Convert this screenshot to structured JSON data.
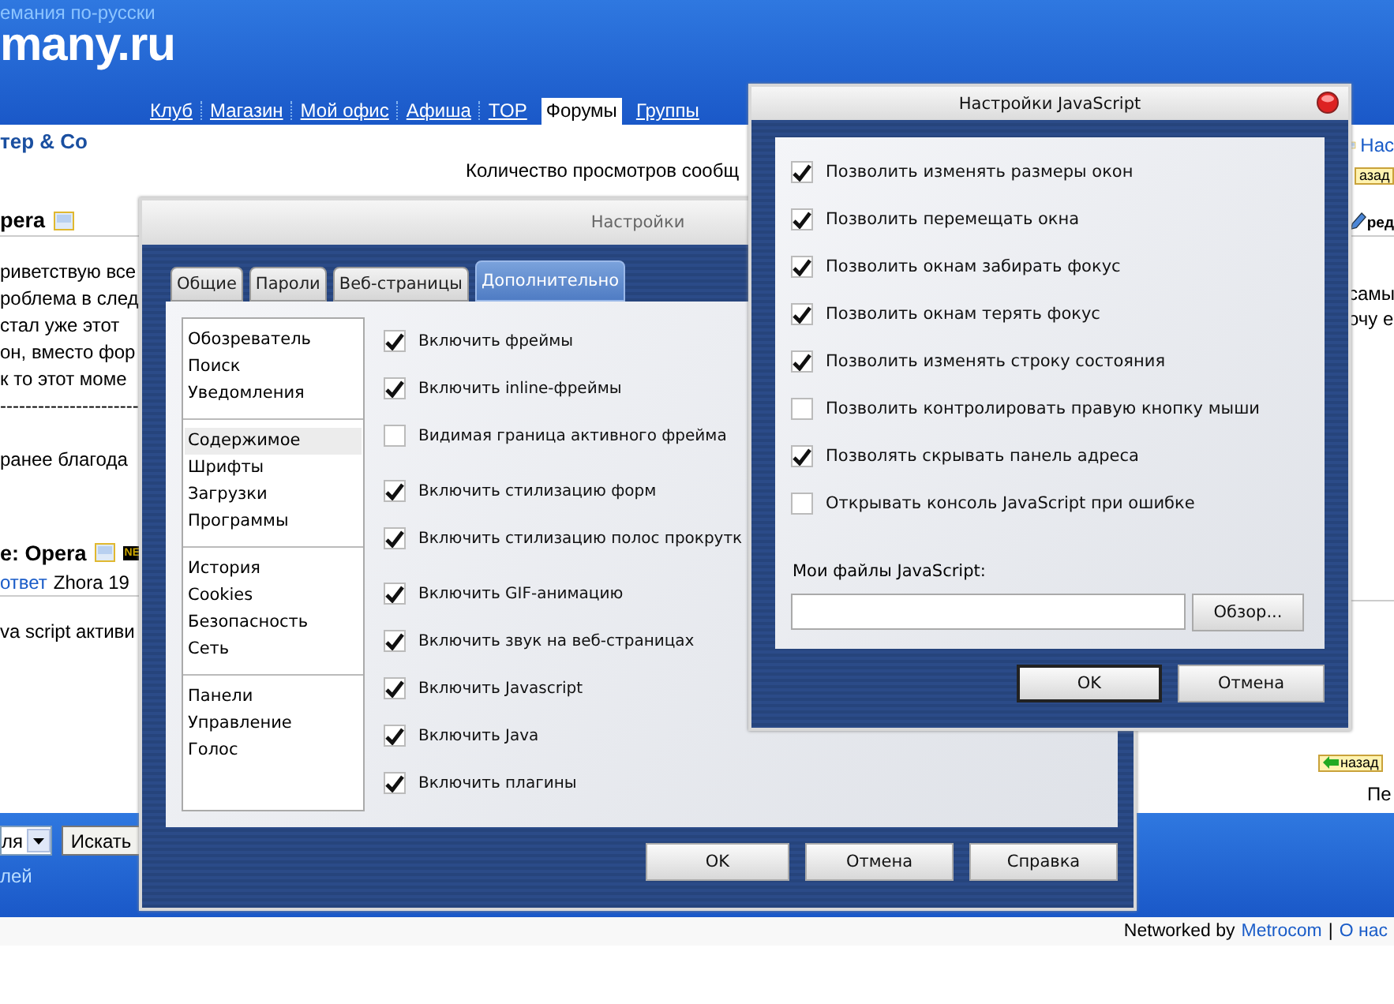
{
  "site": {
    "tagline": "емания по-русски",
    "logo": "many.ru",
    "nav": [
      {
        "label": "Клуб",
        "selected": false
      },
      {
        "label": "Магазин",
        "selected": false
      },
      {
        "label": "Мой офис",
        "selected": false
      },
      {
        "label": "Афиша",
        "selected": false
      },
      {
        "label": "TOP",
        "selected": false
      },
      {
        "label": "Форумы",
        "selected": true
      },
      {
        "label": "Группы",
        "selected": false
      }
    ]
  },
  "content": {
    "forum_title": "тер & Co",
    "views_text": "Количество просмотров сообщ",
    "posts": [
      {
        "title": "pera",
        "lines": [
          "риветствую все",
          "роблема в след",
          "стал уже этот",
          "он, вместо фор",
          "к то этот моме",
          "----------------------"
        ],
        "closing": "ранее благода"
      },
      {
        "title": "e: Opera",
        "badge": "NE",
        "reply_link": "ответ",
        "meta": "Zhora 19",
        "lines": [
          "va script активи"
        ]
      }
    ],
    "right": {
      "link": "Нас",
      "back_top": "азад",
      "edit": "ред",
      "lines": [
        "самы",
        "очу е"
      ],
      "back_bottom": "назад",
      "page": "Пе"
    }
  },
  "footer": {
    "select_value": "ля",
    "search_button": "Искать",
    "link": "лей"
  },
  "credit": {
    "text": "Networked by",
    "link": "Metrocom",
    "separator": "|",
    "about": "О нас"
  },
  "settings": {
    "title": "Настройки",
    "tabs": [
      {
        "label": "Общие",
        "selected": false
      },
      {
        "label": "Пароли",
        "selected": false
      },
      {
        "label": "Веб-страницы",
        "selected": false
      },
      {
        "label": "Дополнительно",
        "selected": true
      }
    ],
    "categories": [
      [
        {
          "label": "Обозреватель",
          "selected": false
        },
        {
          "label": "Поиск",
          "selected": false
        },
        {
          "label": "Уведомления",
          "selected": false
        }
      ],
      [
        {
          "label": "Содержимое",
          "selected": true
        },
        {
          "label": "Шрифты",
          "selected": false
        },
        {
          "label": "Загрузки",
          "selected": false
        },
        {
          "label": "Программы",
          "selected": false
        }
      ],
      [
        {
          "label": "История",
          "selected": false
        },
        {
          "label": "Cookies",
          "selected": false
        },
        {
          "label": "Безопасность",
          "selected": false
        },
        {
          "label": "Сеть",
          "selected": false
        }
      ],
      [
        {
          "label": "Панели",
          "selected": false
        },
        {
          "label": "Управление",
          "selected": false
        },
        {
          "label": "Голос",
          "selected": false
        }
      ]
    ],
    "option_groups": [
      [
        {
          "label": "Включить фреймы",
          "checked": true
        },
        {
          "label": "Включить inline-фреймы",
          "checked": true
        },
        {
          "label": "Видимая граница активного фрейма",
          "checked": false
        }
      ],
      [
        {
          "label": "Включить стилизацию форм",
          "checked": true
        },
        {
          "label": "Включить стилизацию полос прокрутк",
          "checked": true
        }
      ],
      [
        {
          "label": "Включить GIF-анимацию",
          "checked": true
        },
        {
          "label": "Включить звук на веб-страницах",
          "checked": true
        },
        {
          "label": "Включить Javascript",
          "checked": true
        },
        {
          "label": "Включить Java",
          "checked": true
        },
        {
          "label": "Включить плагины",
          "checked": true
        }
      ]
    ],
    "buttons": [
      {
        "label": "OK",
        "default": false
      },
      {
        "label": "Отмена",
        "default": false
      },
      {
        "label": "Справка",
        "default": false
      }
    ]
  },
  "js_settings": {
    "title": "Настройки JavaScript",
    "options": [
      {
        "label": "Позволить изменять размеры окон",
        "checked": true
      },
      {
        "label": "Позволить перемещать окна",
        "checked": true
      },
      {
        "label": "Позволить окнам забирать фокус",
        "checked": true
      },
      {
        "label": "Позволить окнам терять фокус",
        "checked": true
      },
      {
        "label": "Позволить изменять строку состояния",
        "checked": true
      },
      {
        "label": "Позволить контролировать правую кнопку мыши",
        "checked": false
      },
      {
        "label": "Позволять скрывать панель адреса",
        "checked": true
      },
      {
        "label": "Открывать консоль JavaScript при ошибке",
        "checked": false
      }
    ],
    "files_label": "Мои файлы JavaScript:",
    "browse_button": "Обзор...",
    "buttons": [
      {
        "label": "OK",
        "default": true
      },
      {
        "label": "Отмена",
        "default": false
      }
    ]
  }
}
